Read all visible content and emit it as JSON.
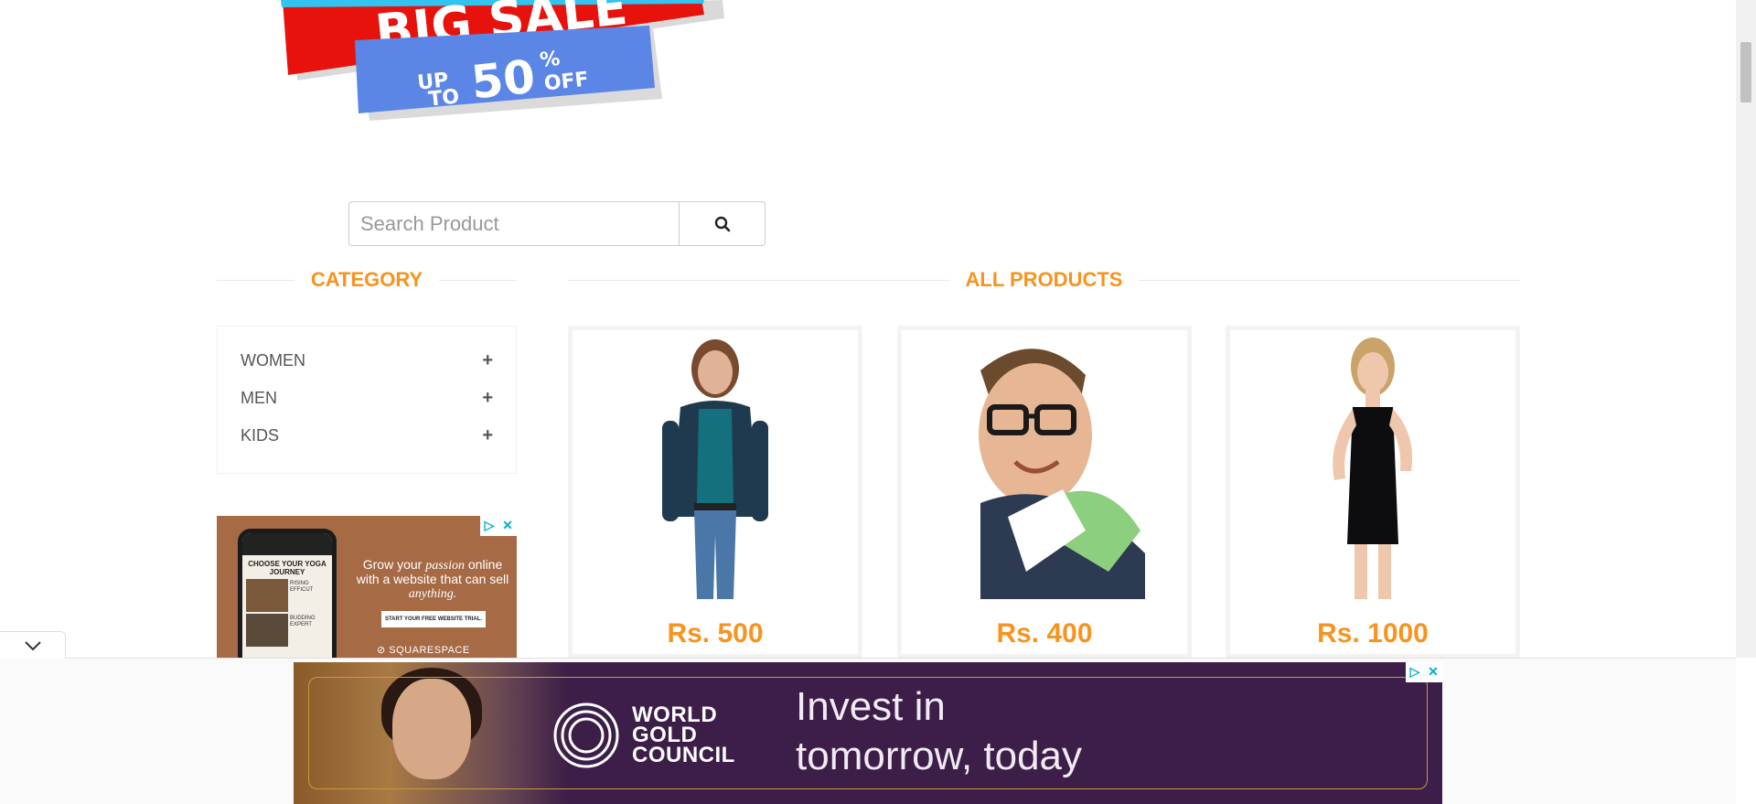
{
  "sale_banner": {
    "title": "BIG SALE",
    "up": "UP",
    "to": "TO",
    "percent": "50",
    "percent_sign": "%",
    "off": "OFF"
  },
  "search": {
    "placeholder": "Search Product",
    "button_icon": "search-icon"
  },
  "category": {
    "title": "CATEGORY",
    "items": [
      {
        "label": "WOMEN",
        "icon": "plus-icon"
      },
      {
        "label": "MEN",
        "icon": "plus-icon"
      },
      {
        "label": "KIDS",
        "icon": "plus-icon"
      }
    ]
  },
  "products": {
    "title": "ALL PRODUCTS",
    "items": [
      {
        "price": "Rs. 500",
        "image": "woman-teal-top-jeans"
      },
      {
        "price": "Rs. 400",
        "image": "man-glasses-smiling"
      },
      {
        "price": "Rs. 1000",
        "image": "woman-black-dress"
      }
    ]
  },
  "side_ad": {
    "phone_title": "CHOOSE YOUR YOGA JOURNEY",
    "row1_text": "RISING EFFICUT",
    "row2_text": "BUDDING EXPERT",
    "copy_prefix": "Grow your",
    "copy_italic1": "passion",
    "copy_middle": "online with a website that can sell",
    "copy_italic2": "anything.",
    "cta": "START YOUR FREE WEBSITE TRIAL.",
    "brand": "SQUARESPACE"
  },
  "bottom_ad": {
    "logo_line1": "WORLD",
    "logo_line2": "GOLD",
    "logo_line3": "COUNCIL",
    "headline_line1": "Invest in",
    "headline_line2": "tomorrow, today"
  },
  "colors": {
    "accent": "#f7931e",
    "sale_red": "#e8120c",
    "sale_blue": "#5b86e5",
    "ad_purple": "#3c1e48"
  }
}
